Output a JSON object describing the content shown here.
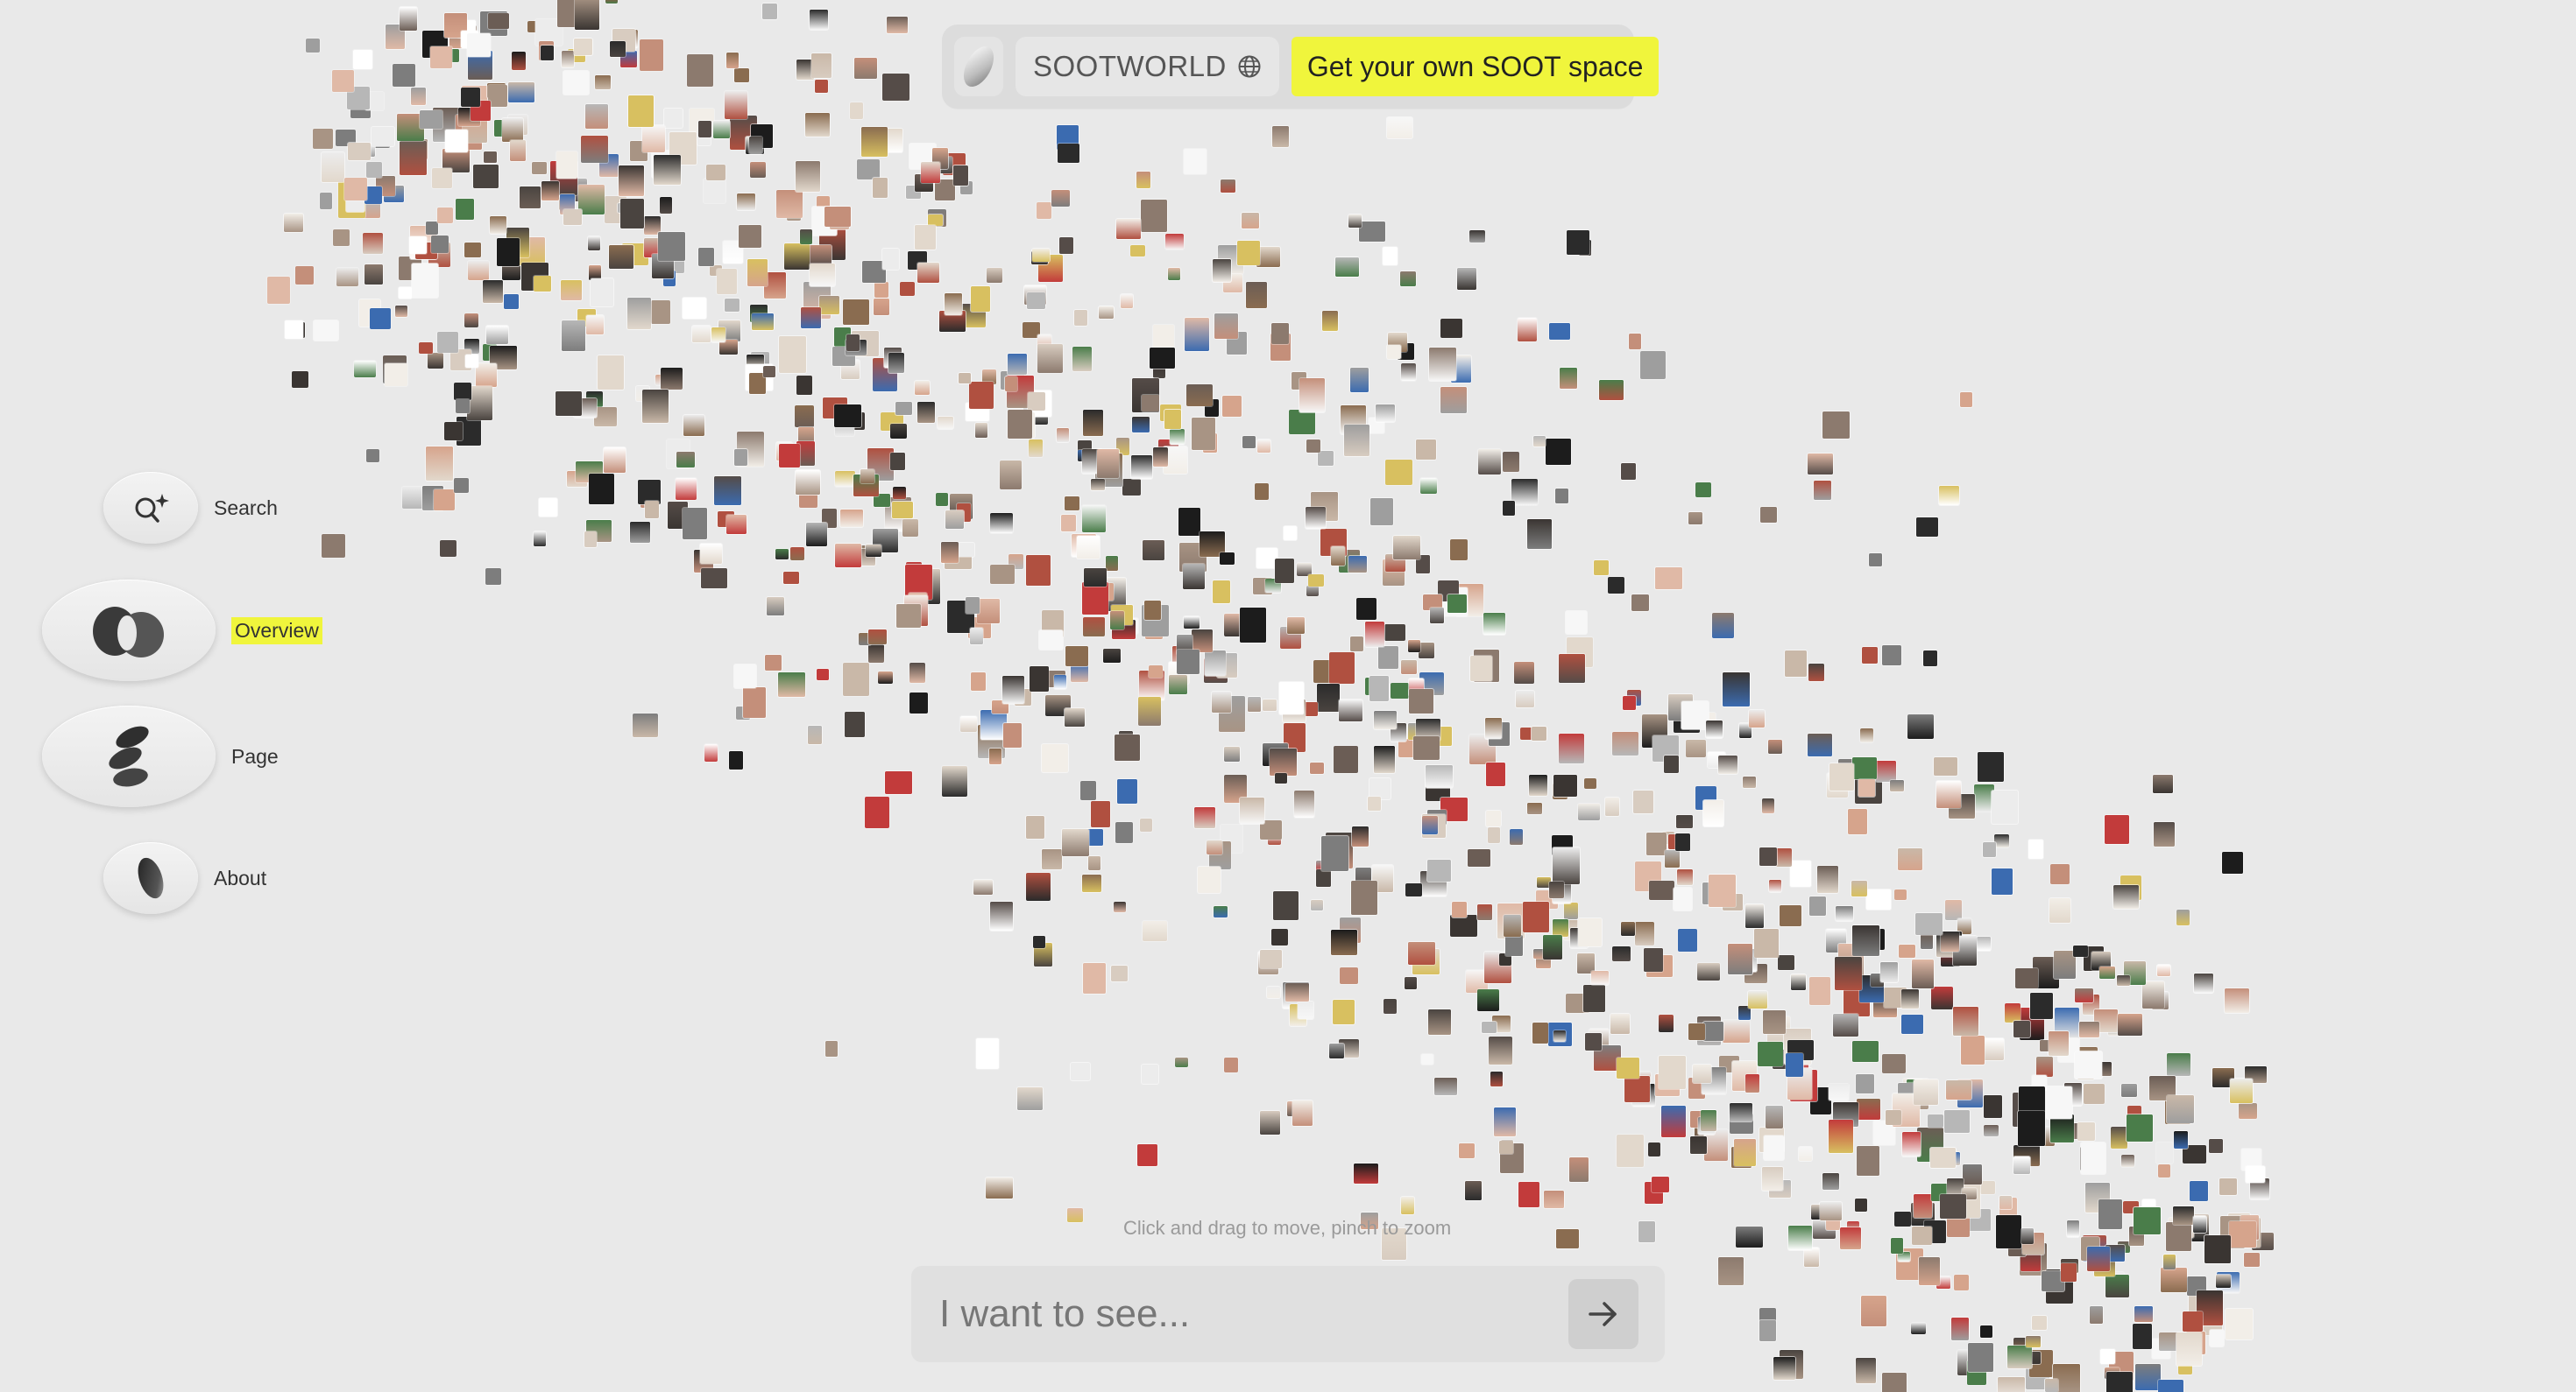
{
  "header": {
    "logo_icon": "soot-pebble-logo",
    "brand_name": "SOOTWORLD",
    "globe_icon": "globe-icon",
    "cta_label": "Get your own SOOT space",
    "cta_color": "#f0f53c"
  },
  "sidebar": {
    "items": [
      {
        "label": "Search",
        "icon": "search-sparkle-icon",
        "active": false
      },
      {
        "label": "Overview",
        "icon": "overlapping-circles-icon",
        "active": true
      },
      {
        "label": "Page",
        "icon": "pebbles-icon",
        "active": false
      },
      {
        "label": "About",
        "icon": "pebble-icon",
        "active": false
      }
    ],
    "active_highlight": "#f0f53c"
  },
  "canvas": {
    "hint": "Click and drag to move, pinch to zoom",
    "content": "image cloud of fashion and product thumbnails"
  },
  "prompt": {
    "placeholder": "I want to see...",
    "submit_icon": "arrow-right-icon"
  },
  "colors": {
    "background": "#e9e9e9",
    "accent": "#f0f53c"
  }
}
